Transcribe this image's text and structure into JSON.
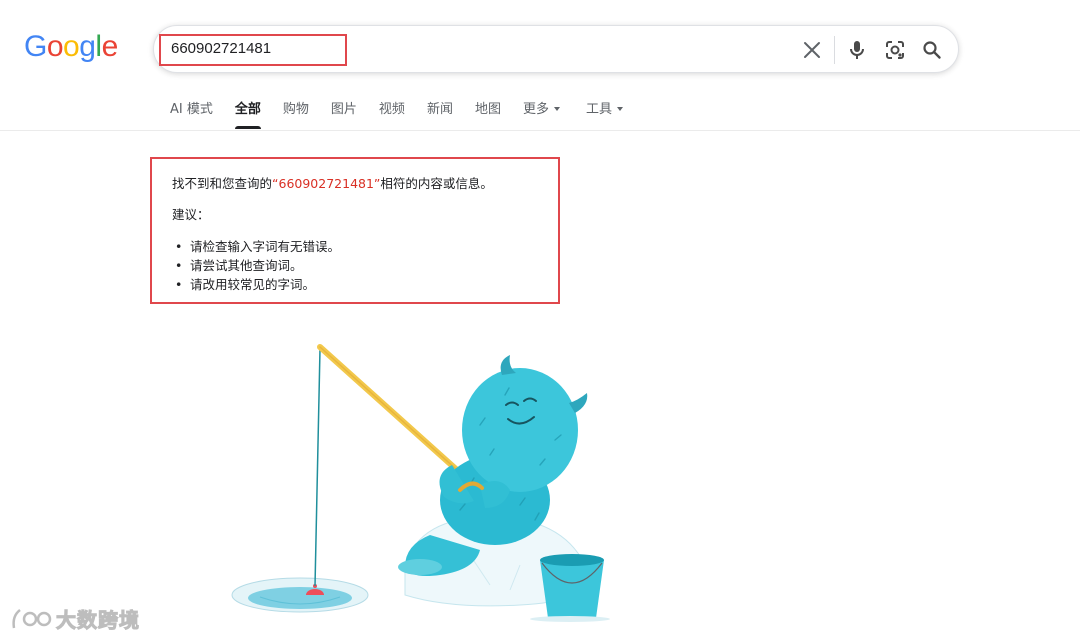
{
  "logo": {
    "letters": [
      "G",
      "o",
      "o",
      "g",
      "l",
      "e"
    ],
    "colors": [
      "#4285F4",
      "#EA4335",
      "#FBBC05",
      "#4285F4",
      "#34A853",
      "#EA4335"
    ]
  },
  "search": {
    "query": "660902721481",
    "icons": [
      "close-icon",
      "microphone-icon",
      "lens-camera-icon",
      "search-icon"
    ]
  },
  "tabs": [
    {
      "label": "AI 模式"
    },
    {
      "label": "全部",
      "active": true
    },
    {
      "label": "购物"
    },
    {
      "label": "图片"
    },
    {
      "label": "视频"
    },
    {
      "label": "新闻"
    },
    {
      "label": "地图"
    },
    {
      "label": "更多",
      "dropdown": true
    },
    {
      "label": "工具",
      "dropdown": true
    }
  ],
  "no_results": {
    "prefix": "找不到和您查询的",
    "query_quoted": "“660902721481”",
    "suffix": "相符的内容或信息。",
    "suggest_heading": "建议：",
    "suggestions": [
      "请检查输入字词有无错误。",
      "请尝试其他查询词。",
      "请改用较常见的字词。"
    ]
  },
  "illustration": {
    "name": "fishing-yeti-illustration"
  },
  "watermark": {
    "text": "大数跨境"
  },
  "colors": {
    "highlight_border": "#e0474c",
    "query_red": "#d93025",
    "text": "#202124",
    "muted": "#5f6368"
  }
}
